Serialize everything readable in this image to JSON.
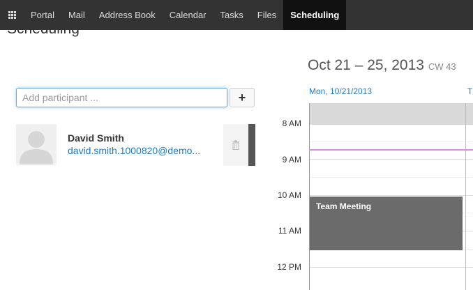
{
  "topbar": {
    "items": [
      {
        "label": "Portal"
      },
      {
        "label": "Mail"
      },
      {
        "label": "Address Book"
      },
      {
        "label": "Calendar"
      },
      {
        "label": "Tasks"
      },
      {
        "label": "Files"
      },
      {
        "label": "Scheduling",
        "active": true
      }
    ]
  },
  "main": {
    "title": "Scheduling",
    "participant_input": {
      "value": "",
      "placeholder": "Add participant ..."
    },
    "add_button": "+",
    "participants": [
      {
        "name": "David Smith",
        "email": "david.smith.1000820@demo..."
      }
    ]
  },
  "calendar": {
    "week_title": "Oct 21 – 25, 2013",
    "cw": "CW 43",
    "days": [
      "Mon, 10/21/2013",
      "T"
    ],
    "times": [
      "8 AM",
      "9 AM",
      "10 AM",
      "11 AM",
      "12 PM"
    ],
    "event": {
      "title": "Team Meeting"
    }
  },
  "colors": {
    "accent": "#1f7ac4",
    "topbar": "#333333",
    "event": "#6b6b6b",
    "now_line": "#e38ce3"
  }
}
